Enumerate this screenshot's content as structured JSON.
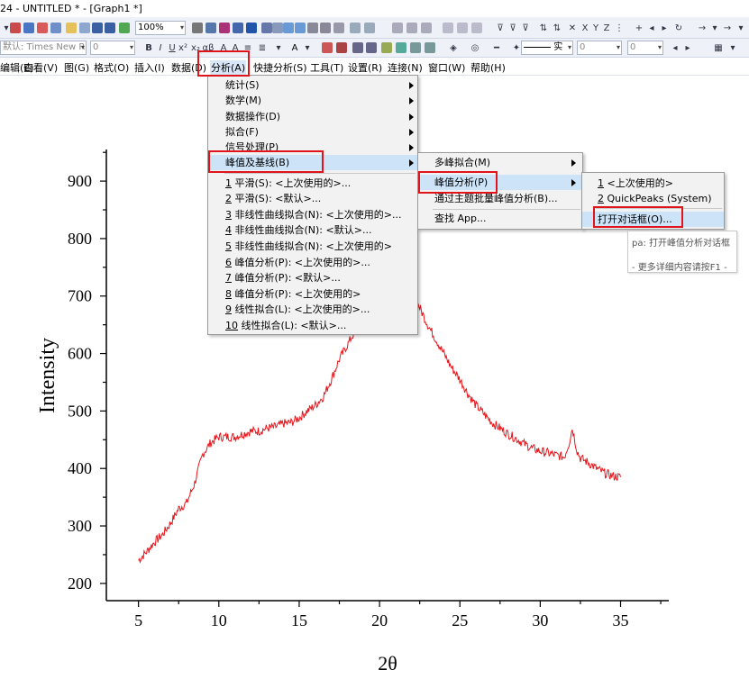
{
  "window": {
    "title": "24 - UNTITLED * - [Graph1 *]"
  },
  "toolbar": {
    "zoom_value": "100%",
    "font_combo": "默认: Times New R",
    "font_size_combo": "0",
    "line_style_label": "实",
    "line_width_combo": "0",
    "fill_combo": "0",
    "bold_label": "B",
    "italic_label": "I",
    "underline_label": "U",
    "axis_letters": [
      "X",
      "Y",
      "Z"
    ]
  },
  "menubar": {
    "items": [
      {
        "label": "编辑(E)"
      },
      {
        "label": "查看(V)"
      },
      {
        "label": "图(G)"
      },
      {
        "label": "格式(O)"
      },
      {
        "label": "插入(I)"
      },
      {
        "label": "数据(D)"
      },
      {
        "label": "分析(A)"
      },
      {
        "label": "快捷分析(S)"
      },
      {
        "label": "工具(T)"
      },
      {
        "label": "设置(R)"
      },
      {
        "label": "连接(N)"
      },
      {
        "label": "窗口(W)"
      },
      {
        "label": "帮助(H)"
      }
    ]
  },
  "analysis_menu": {
    "submenus": [
      {
        "label": "统计(S)"
      },
      {
        "label": "数学(M)"
      },
      {
        "label": "数据操作(D)"
      },
      {
        "label": "拟合(F)"
      },
      {
        "label": "信号处理(P)"
      },
      {
        "label": "峰值及基线(B)"
      }
    ],
    "recent": [
      {
        "num": "1",
        "label": "平滑(S): <上次使用的>..."
      },
      {
        "num": "2",
        "label": "平滑(S): <默认>..."
      },
      {
        "num": "3",
        "label": "非线性曲线拟合(N): <上次使用的>..."
      },
      {
        "num": "4",
        "label": "非线性曲线拟合(N): <默认>..."
      },
      {
        "num": "5",
        "label": "非线性曲线拟合(N): <上次使用的>"
      },
      {
        "num": "6",
        "label": "峰值分析(P): <上次使用的>..."
      },
      {
        "num": "7",
        "label": "峰值分析(P): <默认>..."
      },
      {
        "num": "8",
        "label": "峰值分析(P): <上次使用的>"
      },
      {
        "num": "9",
        "label": "线性拟合(L): <上次使用的>..."
      },
      {
        "num": "10",
        "label": "线性拟合(L): <默认>..."
      }
    ]
  },
  "peak_menu": {
    "items": [
      {
        "label": "多峰拟合(M)"
      },
      {
        "label": "峰值分析(P)"
      },
      {
        "label": "通过主题批量峰值分析(B)..."
      },
      {
        "label": "查找 App..."
      }
    ]
  },
  "peak_analysis_menu": {
    "items": [
      {
        "num": "1",
        "label": "<上次使用的>"
      },
      {
        "num": "2",
        "label": "QuickPeaks (System)"
      },
      {
        "label": "打开对话框(O)..."
      }
    ]
  },
  "tooltip": {
    "line1": "pa: 打开峰值分析对话框",
    "line2": "- 更多详细内容请按F1 -"
  },
  "chart_data": {
    "type": "line",
    "xlabel": "2θ",
    "ylabel": "Intensity",
    "xlim": [
      3,
      38
    ],
    "ylim": [
      170,
      955
    ],
    "x_ticks": [
      5,
      10,
      15,
      20,
      25,
      30,
      35
    ],
    "y_ticks": [
      200,
      300,
      400,
      500,
      600,
      700,
      800,
      900
    ],
    "series": [
      {
        "color": "#e8141a",
        "x": [
          5,
          5.5,
          6,
          6.5,
          7,
          7.5,
          8,
          8.5,
          9,
          9.5,
          10,
          10.5,
          11,
          11.5,
          12,
          12.5,
          13,
          13.5,
          14,
          14.5,
          15,
          15.5,
          16,
          16.5,
          17,
          17.5,
          18,
          18.5,
          19,
          19.5,
          20,
          20.5,
          21,
          21.5,
          22,
          22.5,
          23,
          23.5,
          24,
          24.5,
          25,
          25.5,
          26,
          26.5,
          27,
          27.5,
          28,
          28.5,
          29,
          29.5,
          30,
          30.5,
          31,
          31.5,
          31.8,
          32,
          32.3,
          32.5,
          33,
          33.5,
          34,
          34.5,
          35
        ],
        "y": [
          240,
          255,
          272,
          285,
          305,
          330,
          340,
          375,
          425,
          445,
          455,
          455,
          455,
          460,
          465,
          465,
          470,
          472,
          478,
          480,
          488,
          500,
          510,
          525,
          555,
          590,
          615,
          640,
          680,
          710,
          735,
          760,
          760,
          730,
          705,
          680,
          650,
          625,
          600,
          575,
          555,
          530,
          510,
          495,
          480,
          470,
          460,
          452,
          443,
          435,
          430,
          427,
          423,
          420,
          445,
          470,
          430,
          418,
          410,
          400,
          392,
          387,
          385
        ]
      }
    ]
  }
}
